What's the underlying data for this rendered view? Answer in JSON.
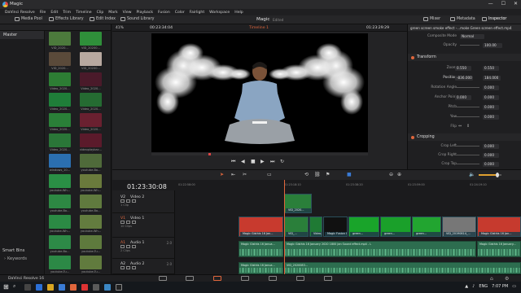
{
  "window": {
    "title": "Magic",
    "controls": [
      "—",
      "☐",
      "✕"
    ]
  },
  "menu": [
    "DaVinci Resolve",
    "File",
    "Edit",
    "Trim",
    "Timeline",
    "Clip",
    "Mark",
    "View",
    "Playback",
    "Fusion",
    "Color",
    "Fairlight",
    "Workspace",
    "Help"
  ],
  "toolbar": {
    "media_pool": "Media Pool",
    "effects_library": "Effects Library",
    "edit_index": "Edit Index",
    "sound_library": "Sound Library",
    "project_title": "Magic",
    "project_status": "Edited",
    "mixer": "Mixer",
    "metadata": "Metadata",
    "inspector": "Inspector"
  },
  "media_pool": {
    "bin_root": "Master",
    "smart_bins": "Smart Bins",
    "keywords": "Keywords",
    "clips": [
      {
        "name": "VID_2020...",
        "color": "#4c7a3c"
      },
      {
        "name": "VID_20200...",
        "color": "#2f8f3a"
      },
      {
        "name": "VID_2020...",
        "color": "#5a4a3a"
      },
      {
        "name": "VID_20200...",
        "color": "#b8a9a0"
      },
      {
        "name": "Video_2020...",
        "color": "#2d7d34"
      },
      {
        "name": "Video_2020...",
        "color": "#4a1a2a"
      },
      {
        "name": "Video_2020...",
        "color": "#1f7e39"
      },
      {
        "name": "Video_2020...",
        "color": "#256b32"
      },
      {
        "name": "Video_2020...",
        "color": "#2a7f38"
      },
      {
        "name": "Video_2020...",
        "color": "#6a2030"
      },
      {
        "name": "Video_2020...",
        "color": "#2a7638"
      },
      {
        "name": "videoplaybac...",
        "color": "#5b1a2b"
      },
      {
        "name": "windows_10...",
        "color": "#2b6fb0"
      },
      {
        "name": "youtube-Bo...",
        "color": "#4f6a3a"
      },
      {
        "name": "youtube-Wh...",
        "color": "#2a8f45"
      },
      {
        "name": "youtube-Wh...",
        "color": "#6a7a3c"
      },
      {
        "name": "youtube-Bo...",
        "color": "#2d8843"
      },
      {
        "name": "youtube-Bo...",
        "color": "#607a3e"
      },
      {
        "name": "youtube-Wh...",
        "color": "#2b8a44"
      },
      {
        "name": "youtube-Wh...",
        "color": "#637c3f"
      },
      {
        "name": "youtube-Bo...",
        "color": "#2d8a47"
      },
      {
        "name": "youtube-Tu...",
        "color": "#5e7a3d"
      },
      {
        "name": "youtube-Tu...",
        "color": "#2c8946"
      },
      {
        "name": "youtube-Tu...",
        "color": "#617b3e"
      }
    ]
  },
  "viewer": {
    "zoom": "41%",
    "source_timecode": "00:23:34:04",
    "timeline_name": "Timeline 1",
    "record_timecode": "01:23:29:29"
  },
  "inspector": {
    "header": "green screen smoke effect -...moke Green screen effect.mp4",
    "composite_mode_label": "Composite Mode",
    "composite_mode": "Normal",
    "opacity_label": "Opacity",
    "opacity": "100.00",
    "transform_label": "Transform",
    "zoom_label": "Zoom",
    "zoom_x": "0.550",
    "zoom_y": "0.550",
    "position_label": "Position",
    "position_x": "-836.000",
    "position_y": "184.000",
    "rotation_label": "Rotation Angle",
    "rotation": "0.000",
    "anchor_label": "Anchor Point",
    "anchor_x": "0.000",
    "anchor_y": "0.000",
    "pitch_label": "Pitch",
    "pitch": "0.000",
    "yaw_label": "Yaw",
    "yaw": "0.000",
    "flip_label": "Flip",
    "cropping_label": "Cropping",
    "crop_left_label": "Crop Left",
    "crop_left": "0.000",
    "crop_right_label": "Crop Right",
    "crop_right": "0.000",
    "crop_top_label": "Crop Top",
    "crop_top": "0.000"
  },
  "timeline": {
    "timecode": "01:23:30:08",
    "ruler": [
      "01:22:58:00",
      "01:23:18:10",
      "01:23:38:20",
      "01:23:59:00",
      "01:24:19:10"
    ],
    "tracks": {
      "v2": {
        "id": "V2",
        "name": "Video 2",
        "clips": "1 Clip"
      },
      "v1": {
        "id": "V1",
        "name": "Video 1",
        "clips": "10 Clips"
      },
      "a1": {
        "id": "A1",
        "name": "Audio 1",
        "level": "2.0",
        "clips": "2 Clips"
      },
      "a2": {
        "id": "A2",
        "name": "Audio 2",
        "level": "2.0"
      }
    },
    "v2_clip": "VID_2020...",
    "v1_clips": [
      "Magic Gisthis 16 Jan...",
      "VID_...",
      "Video_20...",
      "Magic Fusion 01...",
      "green...",
      "green...",
      "green...",
      "VID_20190814_...",
      "Magic Gisthis 16 Jan..."
    ],
    "a1_clips": [
      "Magic Gisthis 16 Janua...",
      "Magic Gisthis 16 January 2020 1800 Jan Sound effect.mp4 - L",
      "Magic Gisthis 16 January..."
    ],
    "a2_clips": [
      "Magic Gisthis 16 Janua...",
      "VID_2020083..."
    ]
  },
  "pagetabs": {
    "app_name": "DaVinci Resolve 16"
  },
  "taskbar": {
    "lang": "ENG",
    "time": "7:07 PM"
  }
}
